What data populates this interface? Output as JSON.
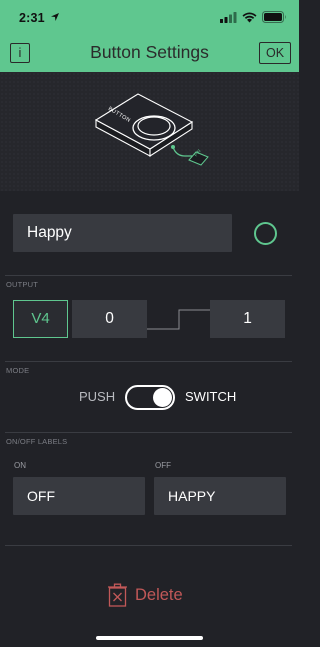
{
  "status_bar": {
    "time": "2:31"
  },
  "header": {
    "info_label": "i",
    "title": "Button Settings",
    "ok_label": "OK"
  },
  "hero": {
    "device_label": "BUTTON",
    "pin_label": "PIN"
  },
  "name": {
    "value": "Happy"
  },
  "accent_color": "#5fc78f",
  "output": {
    "section_label": "OUTPUT",
    "pin": "V4",
    "min_value": "0",
    "max_value": "1"
  },
  "mode": {
    "section_label": "MODE",
    "push_label": "PUSH",
    "switch_label": "SWITCH",
    "selected": "SWITCH"
  },
  "labels": {
    "section_label": "ON/OFF LABELS",
    "on_label": "ON",
    "on_value": "OFF",
    "off_label": "OFF",
    "off_value": "HAPPY"
  },
  "delete": {
    "label": "Delete",
    "icon": "trash-icon"
  }
}
